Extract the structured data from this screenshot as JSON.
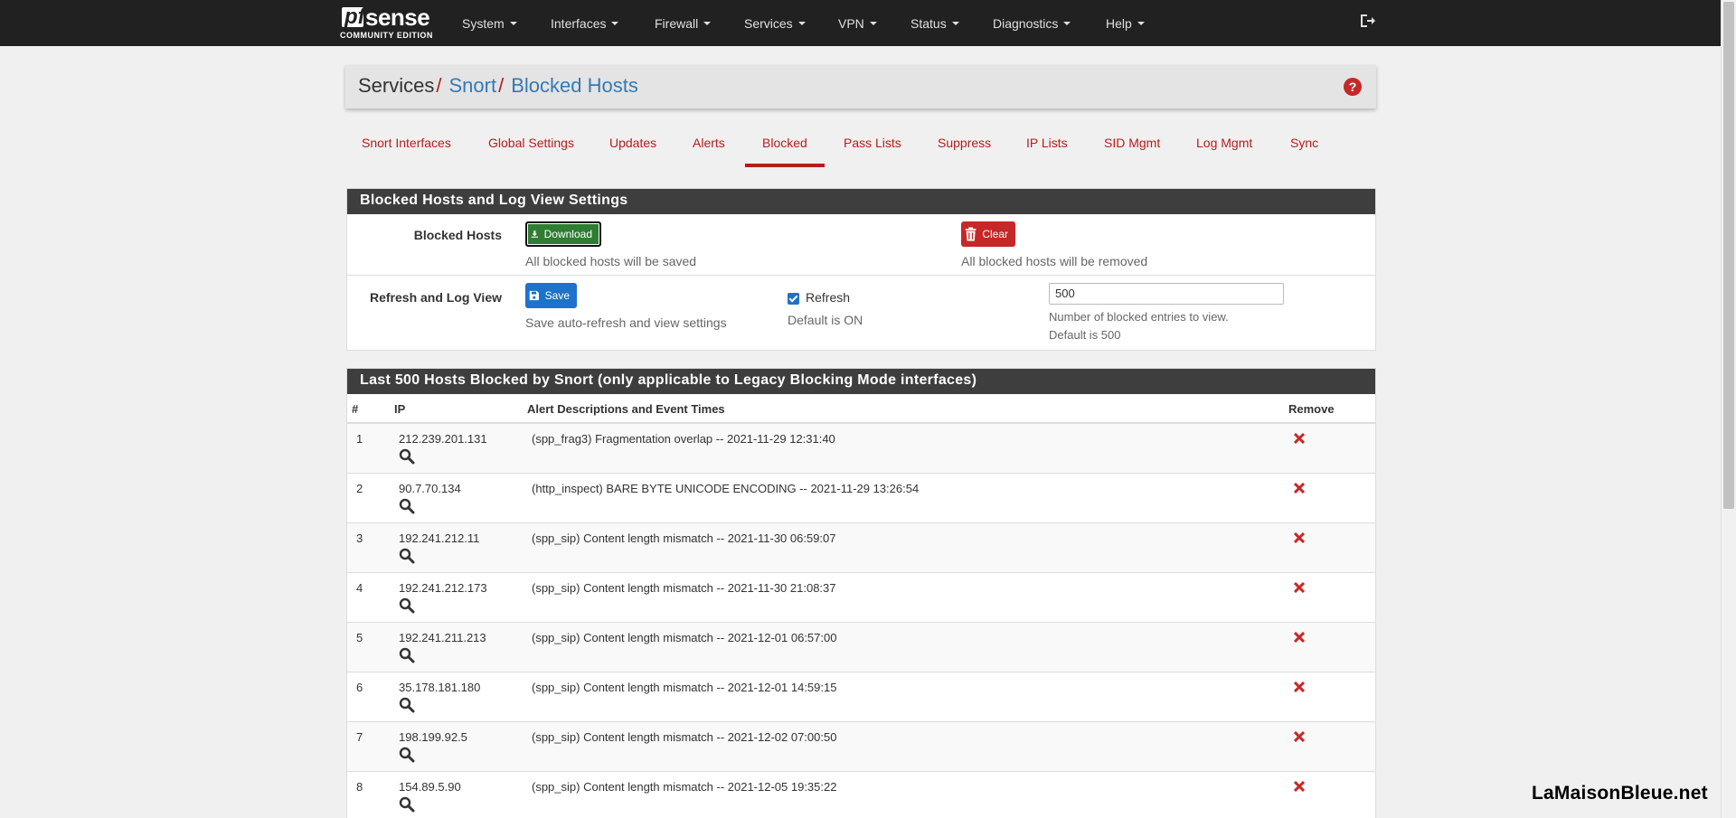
{
  "brand": {
    "name_pf": "pf",
    "name_sense": "sense",
    "edition": "COMMUNITY EDITION"
  },
  "nav": [
    "System",
    "Interfaces",
    "Firewall",
    "Services",
    "VPN",
    "Status",
    "Diagnostics",
    "Help"
  ],
  "breadcrumb": {
    "root": "Services",
    "link1": "Snort",
    "current": "Blocked Hosts",
    "sep": "/"
  },
  "help_icon": "?",
  "tabs": [
    "Snort Interfaces",
    "Global Settings",
    "Updates",
    "Alerts",
    "Blocked",
    "Pass Lists",
    "Suppress",
    "IP Lists",
    "SID Mgmt",
    "Log Mgmt",
    "Sync"
  ],
  "active_tab": "Blocked",
  "settings": {
    "heading": "Blocked Hosts and Log View Settings",
    "blocked_label": "Blocked Hosts",
    "download_label": "Download",
    "download_help": "All blocked hosts will be saved",
    "clear_label": "Clear",
    "clear_help": "All blocked hosts will be removed",
    "refresh_label": "Refresh and Log View",
    "save_label": "Save",
    "save_help": "Save auto-refresh and view settings",
    "refresh_checkbox_label": "Refresh",
    "refresh_checked": true,
    "refresh_help": "Default is ON",
    "entries_value": "500",
    "entries_help1": "Number of blocked entries to view.",
    "entries_help2": "Default is 500"
  },
  "blocked": {
    "heading": "Last 500 Hosts Blocked by Snort (only applicable to Legacy Blocking Mode interfaces)",
    "columns": {
      "num": "#",
      "ip": "IP",
      "desc": "Alert Descriptions and Event Times",
      "remove": "Remove"
    },
    "rows": [
      {
        "num": "1",
        "ip": "212.239.201.131",
        "desc": "(spp_frag3) Fragmentation overlap -- 2021-11-29 12:31:40"
      },
      {
        "num": "2",
        "ip": "90.7.70.134",
        "desc": "(http_inspect) BARE BYTE UNICODE ENCODING -- 2021-11-29 13:26:54"
      },
      {
        "num": "3",
        "ip": "192.241.212.11",
        "desc": "(spp_sip) Content length mismatch -- 2021-11-30 06:59:07"
      },
      {
        "num": "4",
        "ip": "192.241.212.173",
        "desc": "(spp_sip) Content length mismatch -- 2021-11-30 21:08:37"
      },
      {
        "num": "5",
        "ip": "192.241.211.213",
        "desc": "(spp_sip) Content length mismatch -- 2021-12-01 06:57:00"
      },
      {
        "num": "6",
        "ip": "35.178.181.180",
        "desc": "(spp_sip) Content length mismatch -- 2021-12-01 14:59:15"
      },
      {
        "num": "7",
        "ip": "198.199.92.5",
        "desc": "(spp_sip) Content length mismatch -- 2021-12-02 07:00:50"
      },
      {
        "num": "8",
        "ip": "154.89.5.90",
        "desc": "(spp_sip) Content length mismatch -- 2021-12-05 19:35:22"
      }
    ]
  },
  "watermark": "LaMaisonBleue.net",
  "colors": {
    "navbar": "#212121",
    "accent_red": "#b71c1c",
    "link_blue": "#337ab7",
    "panel_heading": "#3e3e3e",
    "download_green": "#2e7d32",
    "save_blue": "#1e72c9"
  }
}
